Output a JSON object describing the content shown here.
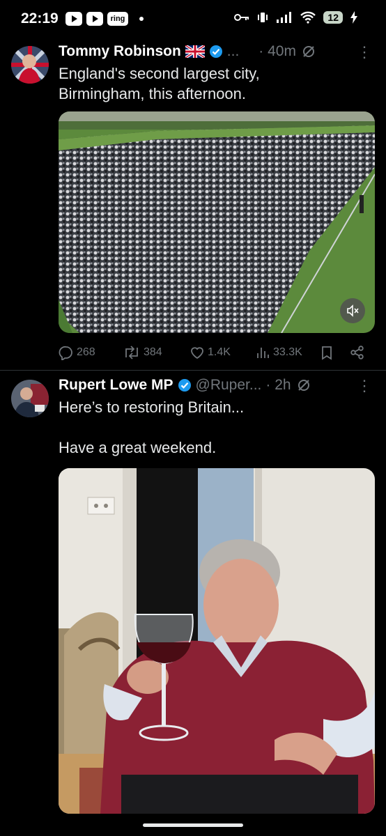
{
  "status_bar": {
    "time": "22:19",
    "ring_label": "ring",
    "battery": "12"
  },
  "tweets": [
    {
      "author": "Tommy Robinson",
      "handle": "...",
      "time": "· 40m",
      "text": "England's second largest city,\nBirmingham, this afternoon.",
      "media_type": "video",
      "stats": {
        "replies": "268",
        "reposts": "384",
        "likes": "1.4K",
        "views": "33.3K"
      }
    },
    {
      "author": "Rupert Lowe MP",
      "handle": "@Ruper...",
      "time": "· 2h",
      "text": "Here’s to restoring Britain...\n\nHave a great weekend.",
      "media_type": "photo"
    }
  ],
  "icons": {
    "verified": "verified-badge-icon",
    "flag": "uk-flag-icon",
    "grok": "grok-icon",
    "more": "more-icon",
    "reply": "reply-icon",
    "repost": "repost-icon",
    "like": "like-icon",
    "views": "views-icon",
    "bookmark": "bookmark-icon",
    "share": "share-icon",
    "mute": "mute-icon"
  },
  "colors": {
    "background": "#000000",
    "text": "#e7e9ea",
    "muted": "#71767b",
    "verified": "#1d9bf0"
  }
}
